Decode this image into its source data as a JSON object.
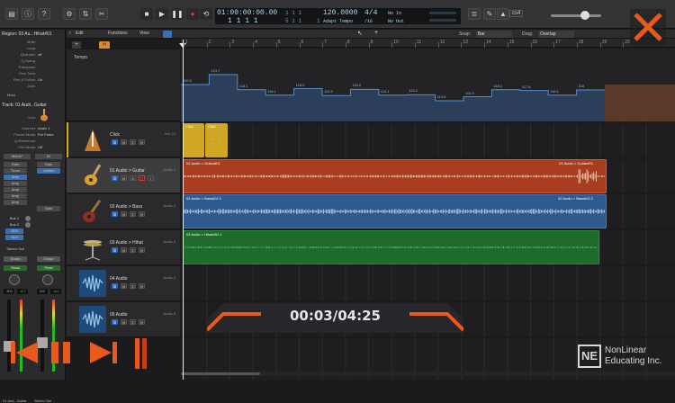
{
  "transport": {
    "position_time": "01:00:00:00.00",
    "position_bars": "1  1  1    1",
    "sub_bars_top": "1  1  1",
    "sub_bars_bottom": "5  1  1",
    "sub_bars_bottom_right": "1",
    "tempo": "120.0000",
    "tempo_mode": "Adapt Tempo",
    "signature": "4/4",
    "division": "/16",
    "input": "No In",
    "output": "No Out",
    "cpu_label": "cs4"
  },
  "menubar": {
    "edit": "Edit",
    "functions": "Functions",
    "view": "View",
    "snap_label": "Snap:",
    "snap_value": "Bar",
    "drag_label": "Drag:",
    "drag_value": "Overlap"
  },
  "global_header": {
    "plus": "+",
    "h": "H",
    "tempo": "Tempo"
  },
  "ruler": [
    "1",
    "2",
    "3",
    "4",
    "5",
    "6",
    "7",
    "8",
    "9",
    "10",
    "11",
    "12",
    "13",
    "14",
    "15",
    "16",
    "17",
    "18",
    "19",
    "20"
  ],
  "tempo_values": [
    "120.0",
    "123.7",
    "118.1",
    "116.1",
    "118.5",
    "115.9",
    "118.2",
    "116.1",
    "116.2",
    "114.0",
    "115.5",
    "118.1",
    "117.8",
    "116.1",
    "118"
  ],
  "inspector": {
    "region_header": "Region: 03 Au...Hihat#01",
    "region_params": [
      [
        "Mute:",
        ""
      ],
      [
        "Loop:",
        ""
      ],
      [
        "Quantize:",
        "off"
      ],
      [
        "Q-Swing:",
        ""
      ],
      [
        "Transpose:",
        ""
      ],
      [
        "Fine Tune:",
        ""
      ],
      [
        "Flex & Follow:",
        "On"
      ],
      [
        "Gain:",
        ""
      ]
    ],
    "more": "More",
    "track_header": "Track: 01 Audi...Guitar",
    "track_params": [
      [
        "Icon:",
        ""
      ],
      [
        "Channel:",
        "Audio 1"
      ],
      [
        "Freeze Mode:",
        "Pre Fader"
      ],
      [
        "Q-Reference:",
        ""
      ],
      [
        "Flex Mode:",
        "Off"
      ]
    ],
    "strip_left": {
      "setting": "M/Ins7",
      "slots": [
        "Gain",
        "Tuner",
        "Amp",
        "Amp",
        "Amp",
        "Amp",
        "Amp"
      ],
      "buses": [
        "Bus 1",
        "Bus 2"
      ],
      "sends": [
        "SD3",
        "SD4"
      ],
      "output": "Stereo Out",
      "group": "Group",
      "read": "Read",
      "pan_l": "-3.0",
      "pan_r": "-4.7",
      "track_label": "01 Aud...Guitar"
    },
    "strip_right": {
      "setting": "ID",
      "slots": [
        "Gain",
        "Limiter"
      ],
      "gain": "Gain",
      "group": "Group",
      "read": "Read",
      "pan_l": "0.0",
      "pan_r": "-4.0",
      "track_label": "Stereo Out"
    }
  },
  "tracks": [
    {
      "name": "Click",
      "num": "Inst 24"
    },
    {
      "name": "01 Audio > Guitar",
      "num": "Audio 1"
    },
    {
      "name": "02 Audio > Bass",
      "num": "Audio 2"
    },
    {
      "name": "03 Audio > Hihat",
      "num": "Audio 3"
    },
    {
      "name": "04 Audio",
      "num": "Audio 4"
    },
    {
      "name": "05 Audio",
      "num": "Audio 5"
    }
  ],
  "track_buttons": {
    "mute": "M",
    "solo": "S",
    "record": "R",
    "input": "I"
  },
  "regions": {
    "click_a": "Click",
    "click_b": "Click",
    "guitar": "01 Audio > Guitar#01",
    "guitar_end": "01 Audio > Guitar#01",
    "bass": "02 Audio > Bass#02.2",
    "bass_end": "02 Audio > Bass#02.2",
    "hihat": "03 Audio > Hihat#01.1"
  },
  "video": {
    "timecode": "00:03/04:25"
  },
  "brand": {
    "line1": "NonLinear",
    "line2": "Educating Inc.",
    "logo": "NE"
  },
  "colors": {
    "guitar": "#a83d1f",
    "bass": "#2e5a8f",
    "hihat": "#1f6b2b",
    "click": "#d1a826",
    "accent": "#e8591b"
  }
}
